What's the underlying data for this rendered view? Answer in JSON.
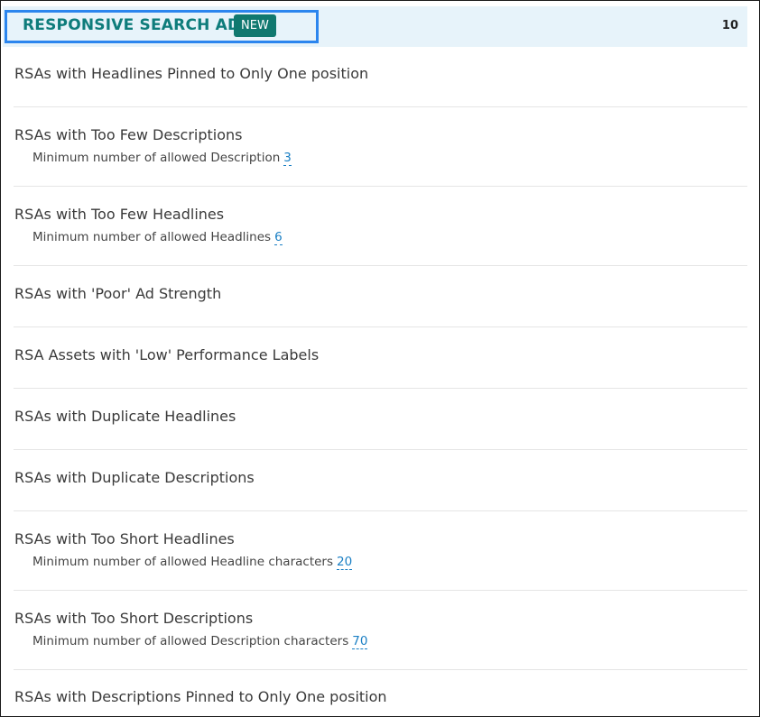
{
  "header": {
    "title": "RESPONSIVE SEARCH ADS",
    "badge": "NEW",
    "count": "10"
  },
  "rows": [
    {
      "title": "RSAs with Headlines Pinned to Only One position"
    },
    {
      "title": "RSAs with Too Few Descriptions",
      "sub_label": "Minimum number of allowed Description",
      "sub_value": "3"
    },
    {
      "title": "RSAs with Too Few Headlines",
      "sub_label": "Minimum number of allowed Headlines",
      "sub_value": "6"
    },
    {
      "title": "RSAs with 'Poor' Ad Strength"
    },
    {
      "title": "RSA Assets with 'Low' Performance Labels"
    },
    {
      "title": "RSAs with Duplicate Headlines"
    },
    {
      "title": "RSAs with Duplicate Descriptions"
    },
    {
      "title": "RSAs with Too Short Headlines",
      "sub_label": "Minimum number of allowed Headline characters",
      "sub_value": "20"
    },
    {
      "title": "RSAs with Too Short Descriptions",
      "sub_label": "Minimum number of allowed Description characters",
      "sub_value": "70"
    },
    {
      "title": "RSAs with Descriptions Pinned to Only One position"
    }
  ]
}
